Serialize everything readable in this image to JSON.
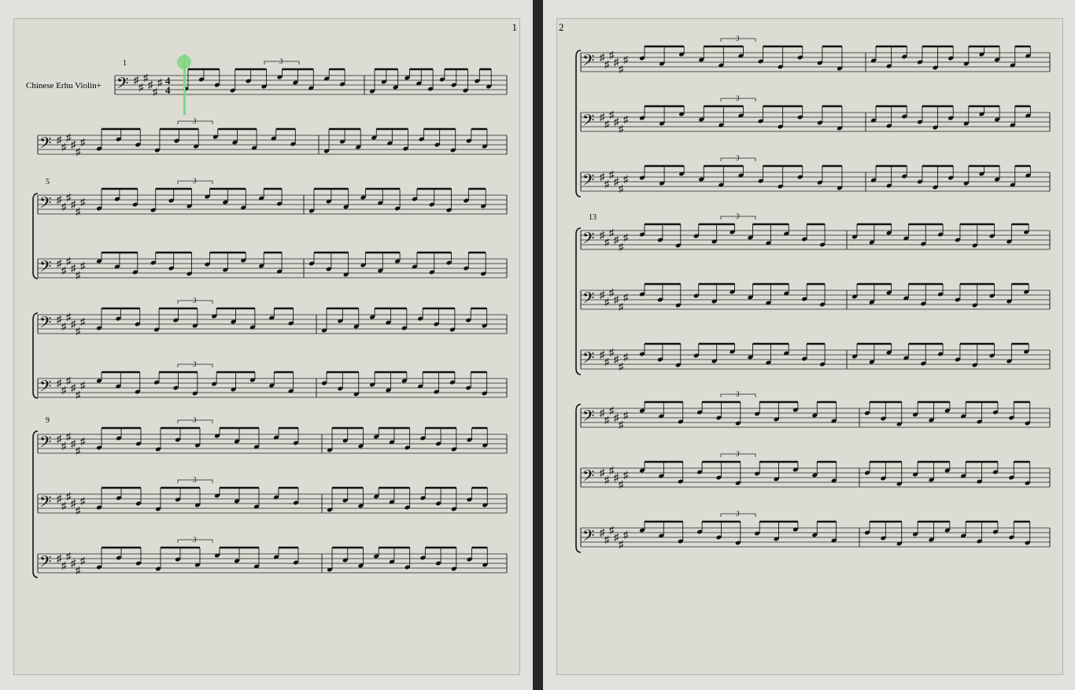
{
  "score": {
    "instrument_name": "Chinese Erhu Violin+",
    "pages": [
      {
        "page_number": "1",
        "measure_numbers": [
          "1",
          "5",
          "9"
        ]
      },
      {
        "page_number": "2",
        "measure_numbers": [
          "13"
        ]
      }
    ],
    "tuplet_label": "3",
    "playback_cursor_color": "#7fd67f",
    "clef_glyph": "𝄢",
    "sharp_glyph": "♯"
  }
}
